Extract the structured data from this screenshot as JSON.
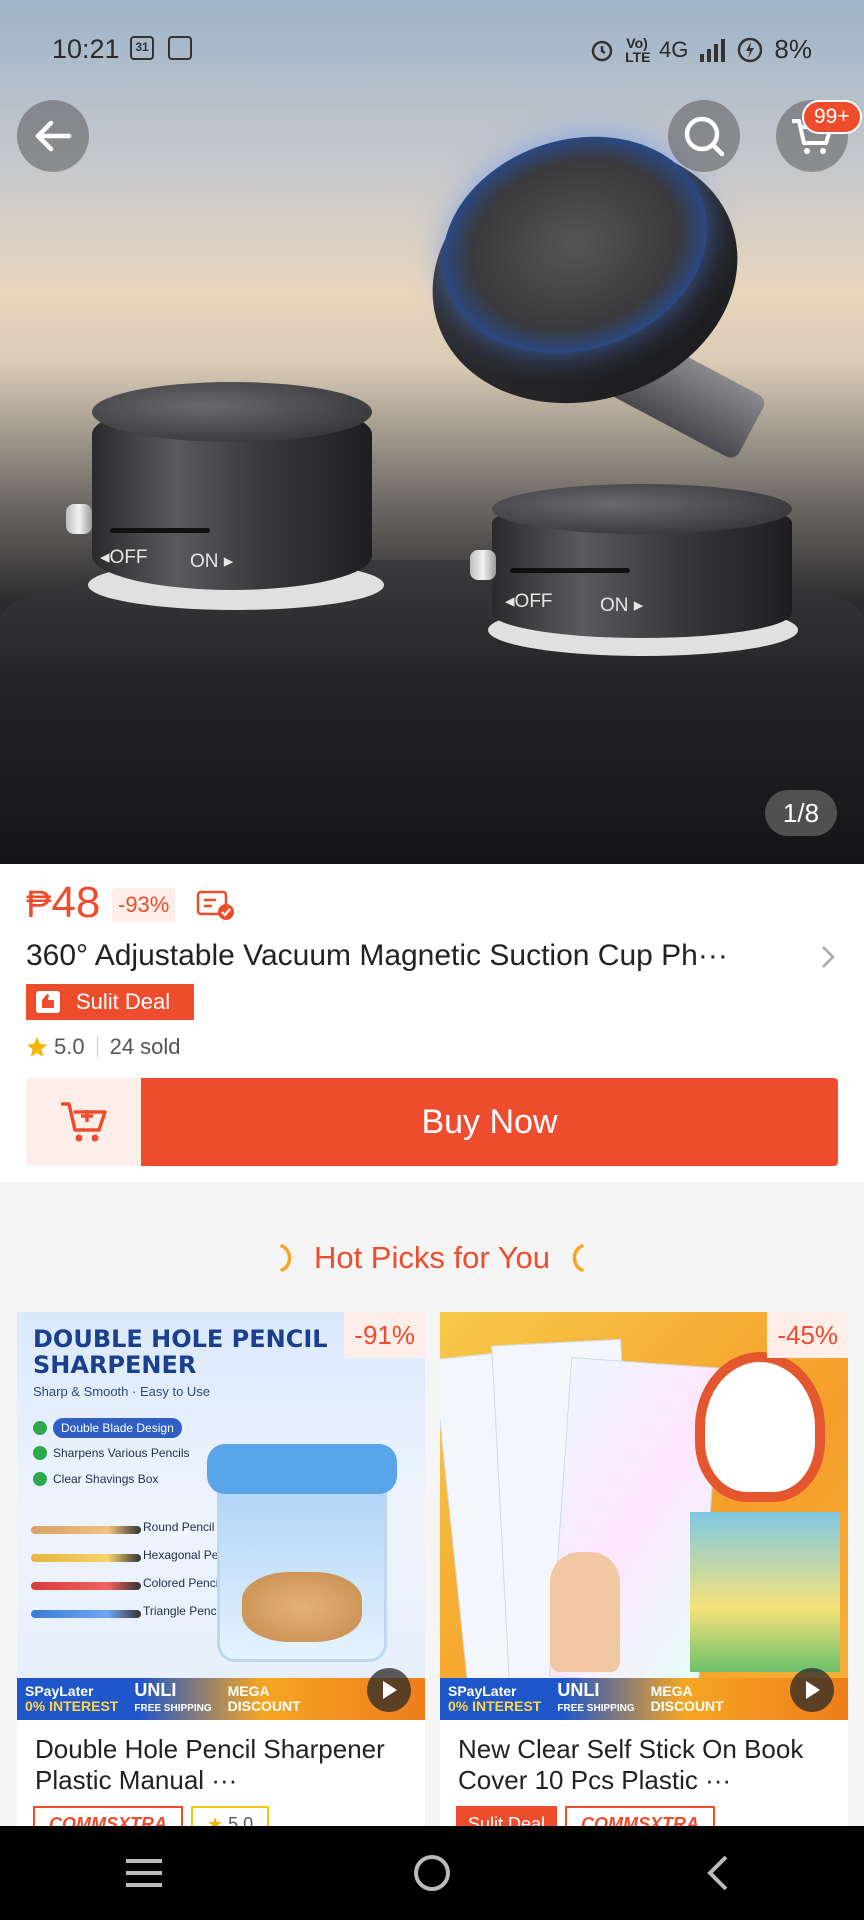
{
  "status_bar": {
    "time": "10:21",
    "calendar_day": "31",
    "network": "4G",
    "volte": "Vo) LTE",
    "battery": "8%"
  },
  "gallery": {
    "counter": "1/8",
    "cart_badge": "99+",
    "device_left_off": "◂OFF",
    "device_left_on": "ON ▸",
    "device_right_off": "◂OFF",
    "device_right_on": "ON ▸"
  },
  "product": {
    "currency": "₱",
    "price": "48",
    "discount": "-93%",
    "title": "360° Adjustable Vacuum Magnetic Suction Cup Ph···",
    "deal_label": "Sulit Deal",
    "rating": "5.0",
    "sold": "24 sold",
    "buy_now_label": "Buy Now"
  },
  "hot_picks": {
    "title": "Hot Picks for You",
    "items": [
      {
        "name": "Double Hole Pencil Sharpener Plastic Manual ···",
        "discount": "-91%",
        "badge1": "COMMSXTRA",
        "badge2": "5.0",
        "art": {
          "title_line1": "DOUBLE HOLE PENCIL",
          "title_line2": "SHARPENER",
          "subtitle": "Sharp & Smooth · Easy to Use",
          "features": [
            "Double Blade Design",
            "Sharpens Various Pencils",
            "Clear Shavings Box"
          ],
          "pencils": [
            "Round Pencil",
            "Hexagonal Pencil",
            "Colored Pencil",
            "Triangle Pencil"
          ]
        }
      },
      {
        "name": "New Clear Self Stick On Book Cover 10 Pcs Plastic ···",
        "discount": "-45%",
        "badge1": "Sulit Deal",
        "badge2": "COMMSXTRA"
      }
    ],
    "promo": {
      "spay": "SPayLater",
      "interest": "0% INTEREST",
      "unli": "UNLI",
      "free_shipping": "FREE SHIPPING",
      "mega": "MEGA",
      "discount": "DISCOUNT"
    }
  },
  "colors": {
    "accent": "#ee4d2d",
    "accent_light": "#fdeee9"
  }
}
